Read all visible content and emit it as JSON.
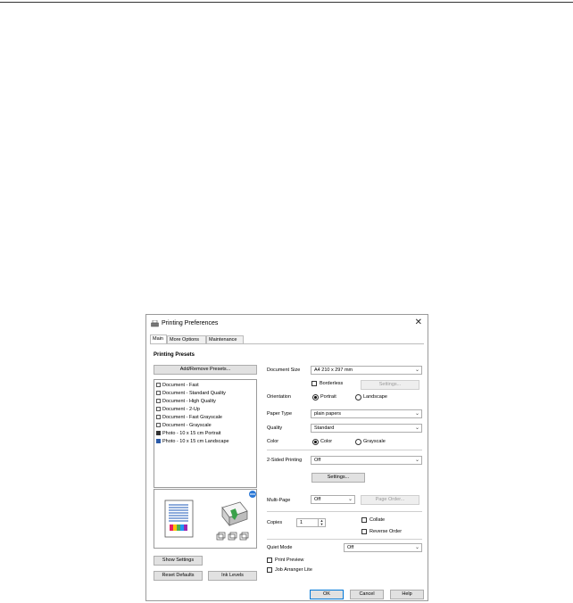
{
  "window": {
    "title": "Printing Preferences",
    "close_glyph": "✕"
  },
  "tabs": [
    {
      "label": "Main"
    },
    {
      "label": "More Options"
    },
    {
      "label": "Maintenance"
    }
  ],
  "presets": {
    "heading": "Printing Presets",
    "add_remove_button": "Add/Remove Presets...",
    "items": [
      "Document - Fast",
      "Document - Standard Quality",
      "Document - High Quality",
      "Document - 2-Up",
      "Document - Fast Grayscale",
      "Document - Grayscale",
      "Photo - 10 x 15 cm Portrait",
      "Photo - 10 x 15 cm Landscape"
    ]
  },
  "left_buttons": {
    "show_settings": "Show Settings",
    "reset_defaults": "Reset Defaults",
    "ink_levels": "Ink Levels"
  },
  "document_size": {
    "label": "Document Size",
    "value": "A4 210 x 297 mm"
  },
  "borderless": {
    "label": "Borderless",
    "checked": false,
    "settings_button": "Settings..."
  },
  "orientation": {
    "label": "Orientation",
    "portrait": "Portrait",
    "landscape": "Landscape",
    "selected": "Portrait"
  },
  "paper_type": {
    "label": "Paper Type",
    "value": "plain papers"
  },
  "quality": {
    "label": "Quality",
    "value": "Standard"
  },
  "color": {
    "label": "Color",
    "color_option": "Color",
    "grayscale_option": "Grayscale",
    "selected": "Color"
  },
  "two_sided": {
    "label": "2-Sided Printing",
    "value": "Off",
    "settings_button": "Settings..."
  },
  "multi_page": {
    "label": "Multi-Page",
    "value": "Off",
    "page_order_button": "Page Order..."
  },
  "copies": {
    "label": "Copies",
    "value": "1",
    "collate": "Collate",
    "reverse_order": "Reverse Order"
  },
  "quiet_mode": {
    "label": "Quiet Mode",
    "value": "Off"
  },
  "print_preview": {
    "label": "Print Preview"
  },
  "job_arranger": {
    "label": "Job Arranger Lite"
  },
  "footer": {
    "ok": "OK",
    "cancel": "Cancel",
    "help": "Help"
  },
  "colors": {
    "accent": "#0078d7",
    "border": "#adadad",
    "button_bg": "#e1e1e1"
  }
}
